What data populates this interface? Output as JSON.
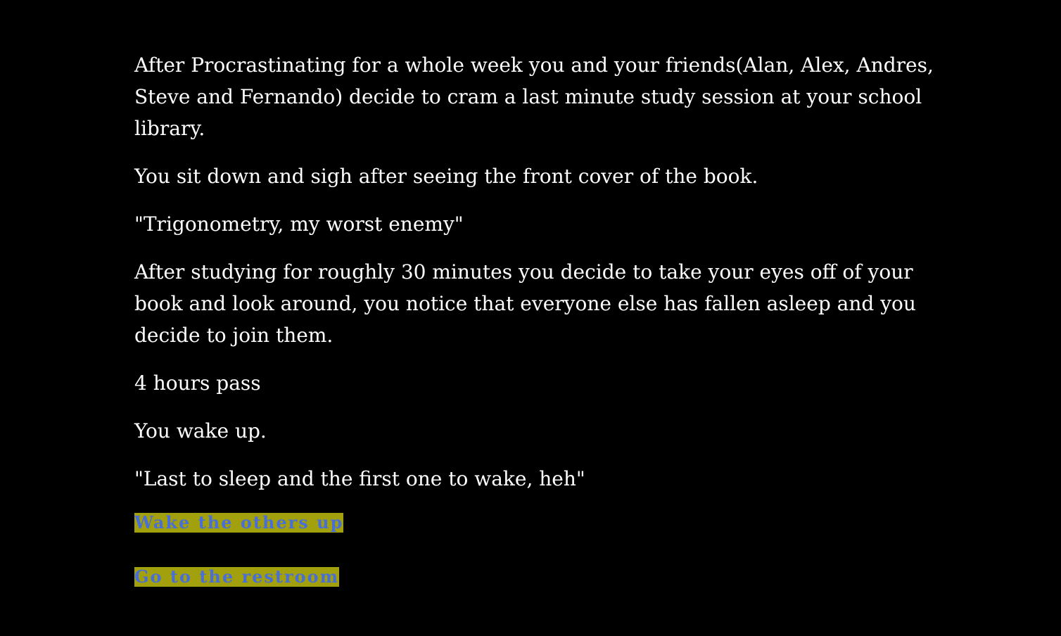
{
  "passage": {
    "paragraphs": [
      "After Procrastinating for a whole week you and your friends(Alan, Alex, Andres, Steve and Fernando) decide to cram a last minute study session at your school library.",
      "You sit down and sigh after seeing the front cover of the book.",
      "\"Trigonometry, my worst enemy\"",
      "After studying for roughly 30 minutes you decide to take your eyes off of your book and look around, you notice that everyone else has fallen asleep and you decide to join them.",
      "4 hours pass",
      "You wake up.",
      "\"Last to sleep and the first one to wake, heh\""
    ]
  },
  "choices": [
    {
      "label": "Wake the others up"
    },
    {
      "label": "Go to the restroom"
    }
  ],
  "colors": {
    "background": "#000000",
    "text": "#ffffff",
    "choice_bg": "#a3a00e",
    "choice_text": "#4a6fd4"
  }
}
